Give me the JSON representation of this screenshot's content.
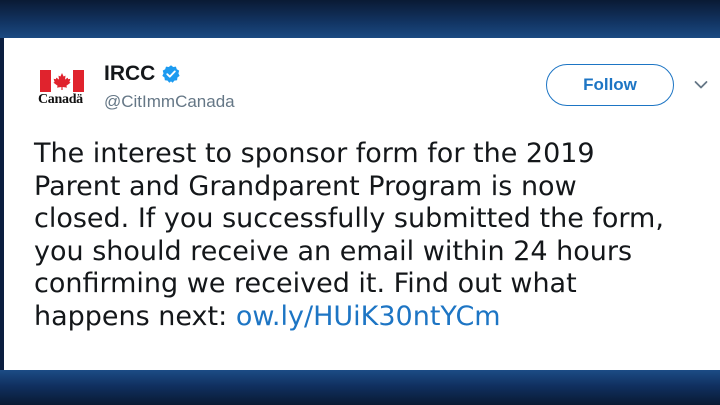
{
  "account": {
    "name": "IRCC",
    "handle": "@CitImmCanada",
    "logo_wordmark": "Canadä",
    "verified": true
  },
  "follow_button": {
    "label": "Follow"
  },
  "tweet": {
    "lines": [
      "The interest to sponsor form for the 2019",
      "Parent and Grandparent Program is now",
      "closed. If you successfully submitted the form,",
      "you should receive an email within 24 hours",
      "confirming we received it. Find out what"
    ],
    "last_line_prefix": "happens next: ",
    "link_text": "ow.ly/HUiK30ntYCm"
  },
  "colors": {
    "accent": "#1d75c4",
    "flag_red": "#e0232d",
    "text": "#14171a",
    "muted": "#657786"
  }
}
